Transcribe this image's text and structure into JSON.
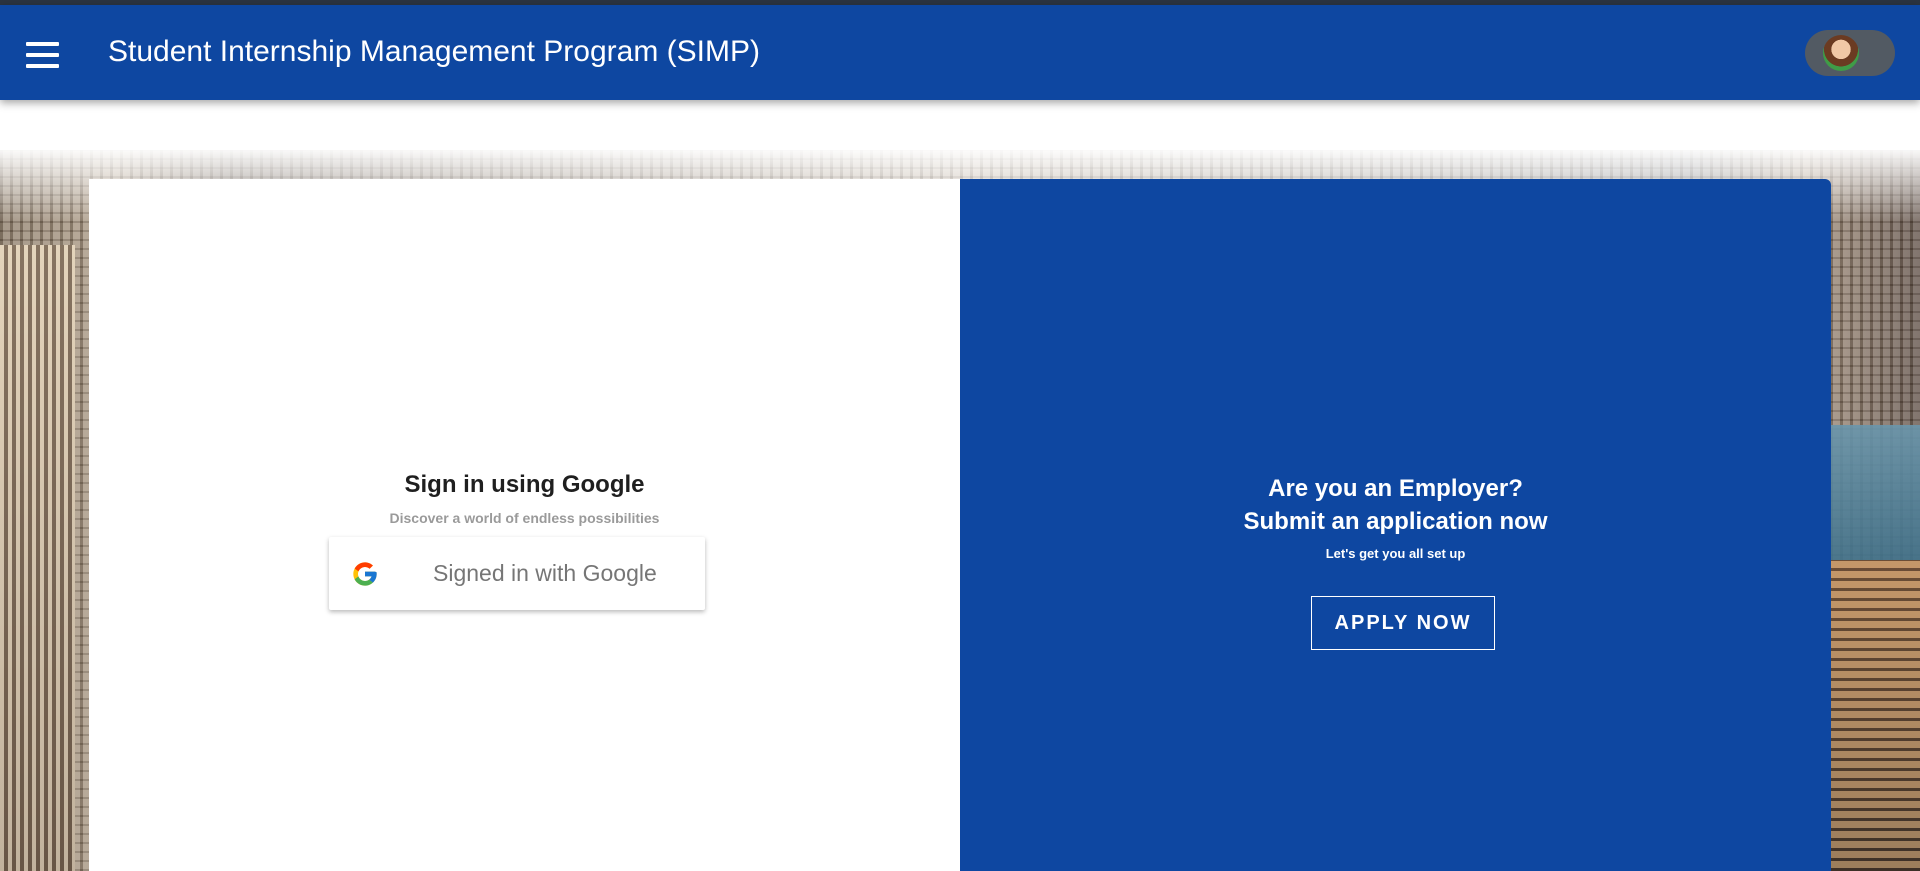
{
  "appbar": {
    "title": "Student Internship Management Program (SIMP)",
    "menu_icon": "hamburger-menu-icon",
    "account_icon": "user-avatar"
  },
  "colors": {
    "primary": "#0e47a1",
    "white": "#ffffff",
    "muted_text": "#9a9a9a"
  },
  "signin": {
    "title": "Sign in using Google",
    "subtitle": "Discover a world of endless possibilities",
    "google_button_label": "Signed in with Google",
    "google_icon": "google-g-icon"
  },
  "employer": {
    "heading_line1": "Are you an Employer?",
    "heading_line2": "Submit an application now",
    "subtitle": "Let's get you all set up",
    "apply_label": "APPLY NOW"
  }
}
